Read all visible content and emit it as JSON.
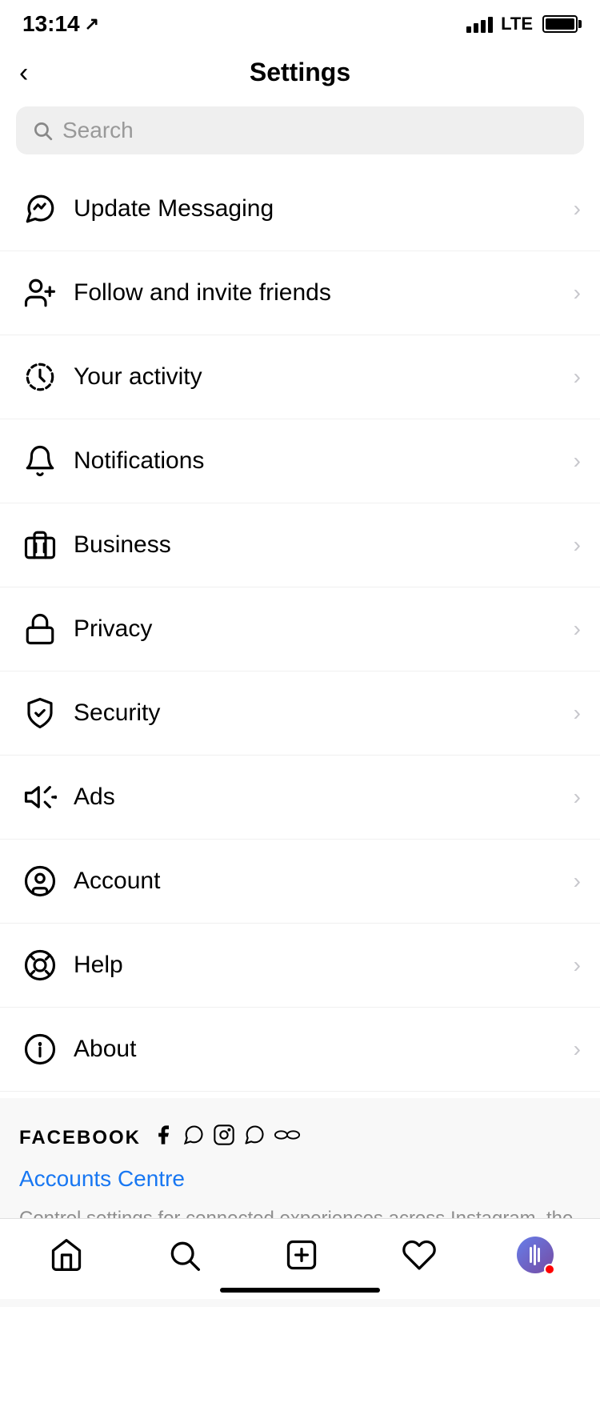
{
  "statusBar": {
    "time": "13:14",
    "indicator": "↗",
    "lte": "LTE"
  },
  "header": {
    "back_label": "‹",
    "title": "Settings"
  },
  "search": {
    "placeholder": "Search"
  },
  "menuItems": [
    {
      "id": "update-messaging",
      "label": "Update Messaging",
      "icon": "messenger"
    },
    {
      "id": "follow-invite",
      "label": "Follow and invite friends",
      "icon": "add-person"
    },
    {
      "id": "your-activity",
      "label": "Your activity",
      "icon": "activity"
    },
    {
      "id": "notifications",
      "label": "Notifications",
      "icon": "bell"
    },
    {
      "id": "business",
      "label": "Business",
      "icon": "business"
    },
    {
      "id": "privacy",
      "label": "Privacy",
      "icon": "lock"
    },
    {
      "id": "security",
      "label": "Security",
      "icon": "shield"
    },
    {
      "id": "ads",
      "label": "Ads",
      "icon": "ads"
    },
    {
      "id": "account",
      "label": "Account",
      "icon": "account"
    },
    {
      "id": "help",
      "label": "Help",
      "icon": "help"
    },
    {
      "id": "about",
      "label": "About",
      "icon": "info"
    }
  ],
  "facebookSection": {
    "label": "FACEBOOK",
    "accountsCentreLink": "Accounts Centre",
    "description": "Control settings for connected experiences across Instagram, the Facebook app and Messenger, including story and post sharing and logging in."
  },
  "bottomNav": [
    {
      "id": "home",
      "icon": "home"
    },
    {
      "id": "search",
      "icon": "search"
    },
    {
      "id": "add",
      "icon": "plus-square"
    },
    {
      "id": "activity",
      "icon": "heart"
    },
    {
      "id": "profile",
      "icon": "avatar"
    }
  ]
}
